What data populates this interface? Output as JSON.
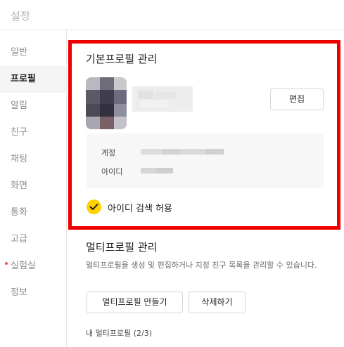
{
  "window": {
    "title": "설정"
  },
  "sidebar": {
    "items": [
      {
        "label": "일반",
        "active": false,
        "new_dot": false
      },
      {
        "label": "프로필",
        "active": true,
        "new_dot": false
      },
      {
        "label": "알림",
        "active": false,
        "new_dot": false
      },
      {
        "label": "친구",
        "active": false,
        "new_dot": false
      },
      {
        "label": "채팅",
        "active": false,
        "new_dot": false
      },
      {
        "label": "화면",
        "active": false,
        "new_dot": false
      },
      {
        "label": "통화",
        "active": false,
        "new_dot": false
      },
      {
        "label": "고급",
        "active": false,
        "new_dot": false
      },
      {
        "label": "실험실",
        "active": false,
        "new_dot": true
      },
      {
        "label": "정보",
        "active": false,
        "new_dot": false
      }
    ]
  },
  "basic_profile": {
    "title": "기본프로필 관리",
    "edit_button": "편집",
    "account_label": "계정",
    "id_label": "아이디",
    "allow_id_search_label": "아이디 검색 허용",
    "allow_id_search_checked": true
  },
  "multi_profile": {
    "title": "멀티프로필 관리",
    "description": "멀티프로필을 생성 및 편집하거나 지정 친구 목록을 관리할 수 있습니다.",
    "create_button": "멀티프로필 만들기",
    "delete_button": "삭제하기",
    "my_profiles_label": "내 멀티프로필 (2/3)"
  },
  "colors": {
    "highlight_border": "#ee0000",
    "checkbox_accent": "#ffd200",
    "new_dot": "#ff4e4e",
    "active_sidebar_bg": "#f5f5f5"
  },
  "icons": {
    "checkbox": "checkmark-icon",
    "new_indicator": "new-dot-icon"
  }
}
